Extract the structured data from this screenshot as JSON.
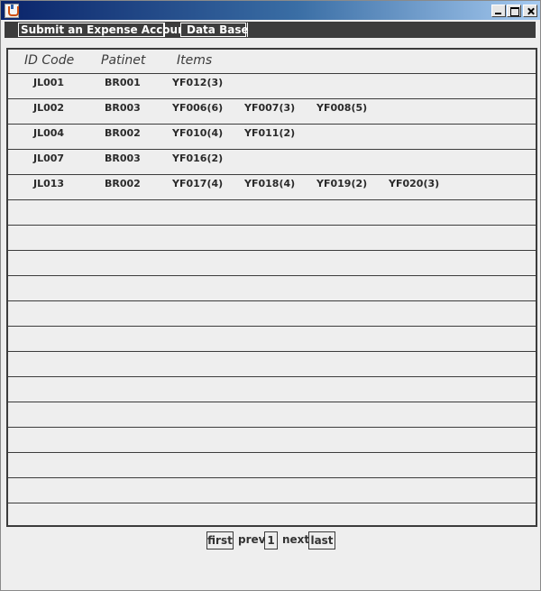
{
  "window": {
    "title": "",
    "icon": "java-cup-icon",
    "titlebar_gradient": [
      "#0a246a",
      "#a6caf0"
    ]
  },
  "toolbar": {
    "submit_label": "Submit an Expense Account",
    "database_label": "Data Base",
    "background": "#3c3c3c"
  },
  "table": {
    "headers": [
      "ID Code",
      "Patinet",
      "Items"
    ],
    "rows": [
      {
        "id": "JL001",
        "patinet": "BR001",
        "items": [
          "YF012(3)"
        ]
      },
      {
        "id": "JL002",
        "patinet": "BR003",
        "items": [
          "YF006(6)",
          "YF007(3)",
          "YF008(5)"
        ]
      },
      {
        "id": "JL004",
        "patinet": "BR002",
        "items": [
          "YF010(4)",
          "YF011(2)"
        ]
      },
      {
        "id": "JL007",
        "patinet": "BR003",
        "items": [
          "YF016(2)"
        ]
      },
      {
        "id": "JL013",
        "patinet": "BR002",
        "items": [
          "YF017(4)",
          "YF018(4)",
          "YF019(2)",
          "YF020(3)"
        ]
      }
    ],
    "empty_rows": 13
  },
  "pager": {
    "first": "first",
    "prev": "prev",
    "page": "1",
    "next": "next",
    "last": "last"
  }
}
